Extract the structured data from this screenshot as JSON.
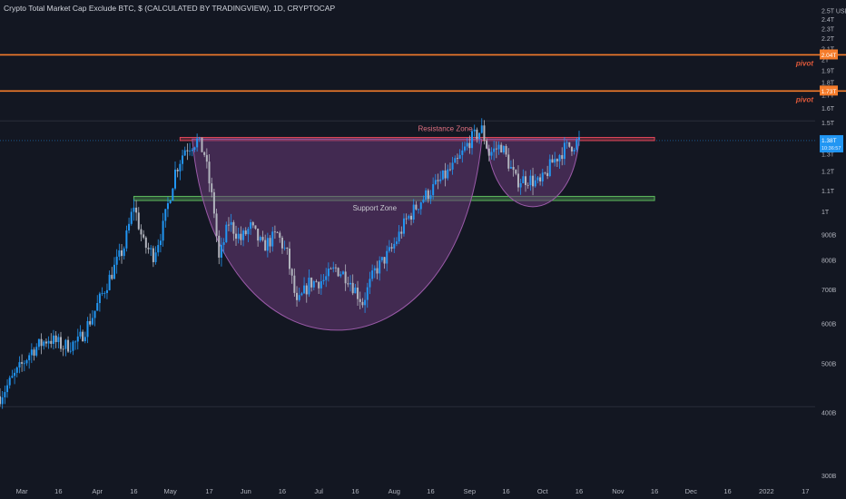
{
  "header": {
    "title": "Crypto Total Market Cap Exclude BTC, $ (CALCULATED BY TRADINGVIEW), 1D, CRYPTOCAP"
  },
  "colors": {
    "background": "#131722",
    "up_candle": "#2196f3",
    "down_candle": "#b2b5be",
    "pivot_line": "#f57c2b",
    "resistance": "#e0465a",
    "support": "#5cb85c",
    "cup_fill": "#6a3a78",
    "price_badge": "#2196f3"
  },
  "chart_data": {
    "type": "candlestick",
    "title": "Crypto Total Market Cap Exclude BTC, $ (CALCULATED BY TRADINGVIEW), 1D, CRYPTOCAP",
    "y_axis": {
      "scale": "log",
      "unit_label": "USD",
      "ticks": [
        {
          "label": "2.5T",
          "value": 2.5
        },
        {
          "label": "2.4T",
          "value": 2.4
        },
        {
          "label": "2.3T",
          "value": 2.3
        },
        {
          "label": "2.2T",
          "value": 2.2
        },
        {
          "label": "2.1T",
          "value": 2.1
        },
        {
          "label": "2T",
          "value": 2.0
        },
        {
          "label": "1.9T",
          "value": 1.9
        },
        {
          "label": "1.8T",
          "value": 1.8
        },
        {
          "label": "1.7T",
          "value": 1.7
        },
        {
          "label": "1.6T",
          "value": 1.6
        },
        {
          "label": "1.5T",
          "value": 1.5
        },
        {
          "label": "1.4T",
          "value": 1.4
        },
        {
          "label": "1.3T",
          "value": 1.3
        },
        {
          "label": "1.2T",
          "value": 1.2
        },
        {
          "label": "1.1T",
          "value": 1.1
        },
        {
          "label": "1T",
          "value": 1.0
        },
        {
          "label": "900B",
          "value": 0.9
        },
        {
          "label": "800B",
          "value": 0.8
        },
        {
          "label": "700B",
          "value": 0.7
        },
        {
          "label": "600B",
          "value": 0.6
        },
        {
          "label": "500B",
          "value": 0.5
        },
        {
          "label": "400B",
          "value": 0.4
        },
        {
          "label": "300B",
          "value": 0.3
        }
      ],
      "range": [
        0.29,
        2.62
      ]
    },
    "x_axis": {
      "ticks": [
        {
          "label": "Mar",
          "date": "2021-03-01"
        },
        {
          "label": "16",
          "date": "2021-03-16"
        },
        {
          "label": "Apr",
          "date": "2021-04-01"
        },
        {
          "label": "16",
          "date": "2021-04-16"
        },
        {
          "label": "May",
          "date": "2021-05-01"
        },
        {
          "label": "17",
          "date": "2021-05-17"
        },
        {
          "label": "Jun",
          "date": "2021-06-01"
        },
        {
          "label": "16",
          "date": "2021-06-16"
        },
        {
          "label": "Jul",
          "date": "2021-07-01"
        },
        {
          "label": "16",
          "date": "2021-07-16"
        },
        {
          "label": "Aug",
          "date": "2021-08-01"
        },
        {
          "label": "16",
          "date": "2021-08-16"
        },
        {
          "label": "Sep",
          "date": "2021-09-01"
        },
        {
          "label": "16",
          "date": "2021-09-16"
        },
        {
          "label": "Oct",
          "date": "2021-10-01"
        },
        {
          "label": "16",
          "date": "2021-10-16"
        },
        {
          "label": "Nov",
          "date": "2021-11-01"
        },
        {
          "label": "16",
          "date": "2021-11-16"
        },
        {
          "label": "Dec",
          "date": "2021-12-01"
        },
        {
          "label": "16",
          "date": "2021-12-16"
        },
        {
          "label": "2022",
          "date": "2022-01-01"
        },
        {
          "label": "17",
          "date": "2022-01-17"
        }
      ],
      "range": [
        "2021-02-20",
        "2022-01-21"
      ]
    },
    "close_path": [
      [
        "2021-02-20",
        0.43
      ],
      [
        "2021-02-27",
        0.48
      ],
      [
        "2021-03-05",
        0.53
      ],
      [
        "2021-03-12",
        0.56
      ],
      [
        "2021-03-18",
        0.54
      ],
      [
        "2021-03-24",
        0.55
      ],
      [
        "2021-03-30",
        0.62
      ],
      [
        "2021-04-05",
        0.72
      ],
      [
        "2021-04-12",
        0.85
      ],
      [
        "2021-04-16",
        1.03
      ],
      [
        "2021-04-20",
        0.86
      ],
      [
        "2021-04-24",
        0.82
      ],
      [
        "2021-04-28",
        0.93
      ],
      [
        "2021-05-03",
        1.2
      ],
      [
        "2021-05-07",
        1.33
      ],
      [
        "2021-05-12",
        1.38
      ],
      [
        "2021-05-15",
        1.3
      ],
      [
        "2021-05-19",
        1.0
      ],
      [
        "2021-05-21",
        0.8
      ],
      [
        "2021-05-25",
        0.95
      ],
      [
        "2021-05-30",
        0.88
      ],
      [
        "2021-06-03",
        0.93
      ],
      [
        "2021-06-08",
        0.85
      ],
      [
        "2021-06-14",
        0.9
      ],
      [
        "2021-06-18",
        0.82
      ],
      [
        "2021-06-22",
        0.65
      ],
      [
        "2021-06-27",
        0.72
      ],
      [
        "2021-07-03",
        0.73
      ],
      [
        "2021-07-08",
        0.77
      ],
      [
        "2021-07-13",
        0.74
      ],
      [
        "2021-07-19",
        0.66
      ],
      [
        "2021-07-24",
        0.76
      ],
      [
        "2021-07-31",
        0.84
      ],
      [
        "2021-08-06",
        0.96
      ],
      [
        "2021-08-12",
        1.05
      ],
      [
        "2021-08-20",
        1.15
      ],
      [
        "2021-08-27",
        1.25
      ],
      [
        "2021-09-01",
        1.38
      ],
      [
        "2021-09-06",
        1.45
      ],
      [
        "2021-09-09",
        1.3
      ],
      [
        "2021-09-14",
        1.35
      ],
      [
        "2021-09-20",
        1.15
      ],
      [
        "2021-09-25",
        1.16
      ],
      [
        "2021-09-30",
        1.13
      ],
      [
        "2021-10-05",
        1.25
      ],
      [
        "2021-10-10",
        1.33
      ],
      [
        "2021-10-14",
        1.36
      ],
      [
        "2021-10-16",
        1.38
      ]
    ],
    "horizontal_lines": [
      {
        "name": "pivot-upper",
        "value": 2.04,
        "axis_label": "2.04T",
        "text": "pivot"
      },
      {
        "name": "pivot-lower",
        "value": 1.73,
        "axis_label": "1.73T",
        "text": "pivot"
      }
    ],
    "zones": [
      {
        "name": "Resistance Zone",
        "label": "Resistance Zone",
        "top": 1.4,
        "bottom": 1.38,
        "start": "2021-05-05",
        "end": "2021-11-16"
      },
      {
        "name": "Support Zone",
        "label": "Support Zone",
        "top": 1.07,
        "bottom": 1.05,
        "start": "2021-04-16",
        "end": "2021-11-16"
      }
    ],
    "cups": [
      {
        "start": "2021-05-10",
        "end": "2021-09-06",
        "top": 1.39,
        "bottom": 0.58
      },
      {
        "start": "2021-09-08",
        "end": "2021-10-16",
        "top": 1.39,
        "bottom": 1.02
      }
    ],
    "current_price": {
      "value": 1.38,
      "label": "1.38T",
      "countdown": "10:36:57"
    },
    "extra_gridlines": [
      1.51,
      0.41
    ],
    "grid": false
  }
}
